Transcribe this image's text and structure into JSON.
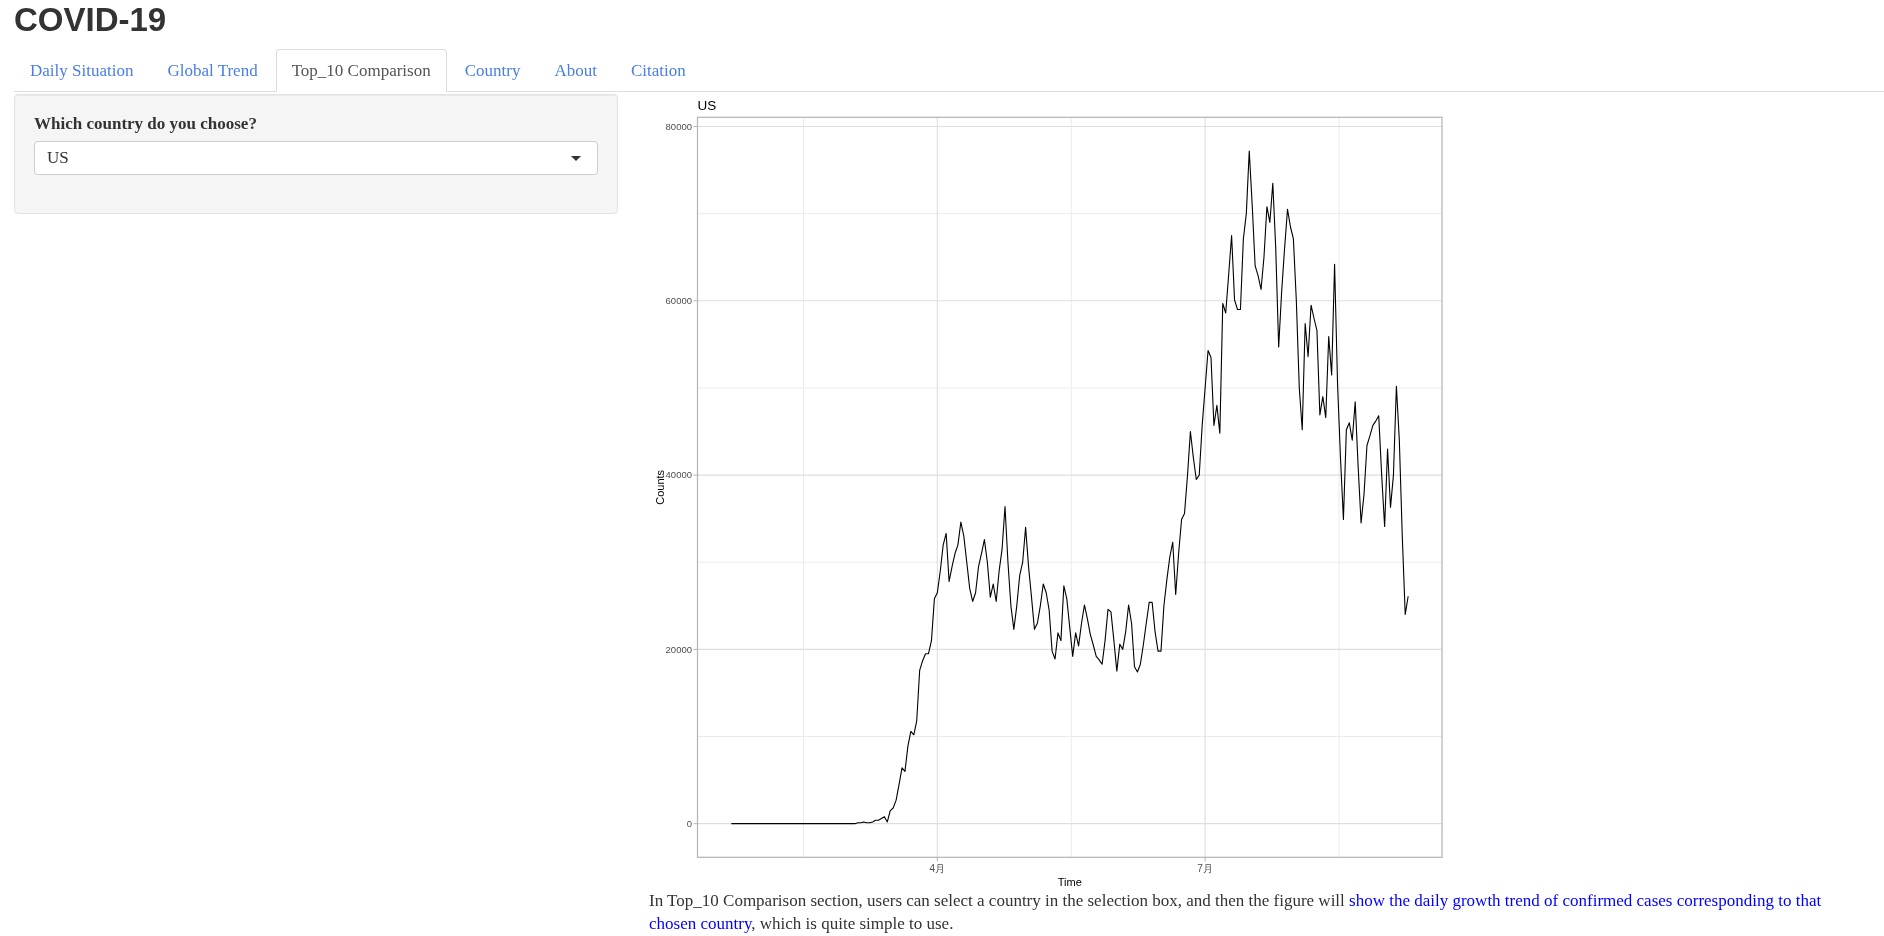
{
  "app": {
    "title": "COVID-19"
  },
  "tabs": [
    {
      "label": "Daily Situation",
      "selected": false
    },
    {
      "label": "Global Trend",
      "selected": false
    },
    {
      "label": "Top_10 Comparison",
      "selected": true
    },
    {
      "label": "Country",
      "selected": false
    },
    {
      "label": "About",
      "selected": false
    },
    {
      "label": "Citation",
      "selected": false
    }
  ],
  "sidebar": {
    "field_label": "Which country do you choose?",
    "country_select": {
      "value": "US"
    }
  },
  "main": {
    "chart_data": {
      "type": "line",
      "title": "US",
      "xlabel": "Time",
      "ylabel": "Counts",
      "grid": true,
      "categories": [
        null,
        null,
        null,
        null,
        null,
        null,
        null,
        null,
        null,
        null,
        null,
        null,
        null,
        null,
        null,
        null,
        null,
        null,
        null,
        null,
        null,
        null,
        null,
        null,
        null,
        null,
        null,
        null,
        null,
        null,
        null,
        null,
        null,
        null,
        null,
        null,
        null,
        null,
        null,
        null,
        null,
        null,
        null,
        null,
        null,
        null,
        null,
        null,
        null,
        null,
        null,
        null,
        null,
        null,
        null,
        null,
        null,
        null,
        null,
        null,
        null,
        null,
        null,
        null,
        null,
        null,
        null,
        null,
        null,
        null,
        "4月",
        null,
        null,
        null,
        null,
        null,
        null,
        null,
        null,
        null,
        null,
        null,
        null,
        null,
        null,
        null,
        null,
        null,
        null,
        null,
        null,
        null,
        null,
        null,
        null,
        null,
        null,
        null,
        null,
        null,
        null,
        null,
        null,
        null,
        null,
        null,
        null,
        null,
        null,
        null,
        null,
        null,
        null,
        null,
        null,
        null,
        null,
        null,
        null,
        null,
        null,
        null,
        null,
        null,
        null,
        null,
        null,
        null,
        null,
        null,
        null,
        null,
        null,
        null,
        null,
        null,
        null,
        null,
        null,
        null,
        null,
        null,
        null,
        null,
        null,
        null,
        null,
        null,
        null,
        null,
        null,
        null,
        null,
        null,
        null,
        null,
        null,
        null,
        null,
        null,
        null,
        "7月",
        null,
        null,
        null,
        null,
        null,
        null,
        null,
        null,
        null,
        null,
        null,
        null,
        null,
        null,
        null,
        null,
        null,
        null,
        null,
        null,
        null,
        null,
        null,
        null,
        null,
        null,
        null,
        null,
        null,
        null,
        null,
        null,
        null,
        null,
        null,
        null,
        null,
        null,
        null,
        null,
        null,
        null,
        null,
        null,
        null,
        null,
        null,
        null,
        null,
        null,
        null,
        null,
        null,
        null,
        null,
        null,
        null,
        null,
        null,
        null,
        null,
        null,
        null,
        null,
        null,
        null,
        null,
        null,
        null
      ],
      "values": [
        0,
        0,
        0,
        0,
        0,
        0,
        0,
        0,
        0,
        0,
        0,
        0,
        0,
        0,
        0,
        0,
        0,
        0,
        0,
        0,
        0,
        0,
        0,
        0,
        0,
        0,
        0,
        0,
        0,
        0,
        0,
        0,
        0,
        0,
        0,
        0,
        0,
        0,
        0,
        0,
        0,
        0,
        0,
        100,
        100,
        200,
        100,
        100,
        200,
        400,
        400,
        600,
        800,
        200,
        1500,
        1800,
        2700,
        4500,
        6400,
        6000,
        8900,
        10600,
        10200,
        11800,
        17600,
        18700,
        19500,
        19500,
        21000,
        25800,
        26500,
        29000,
        32000,
        33300,
        27800,
        29500,
        31000,
        32000,
        34600,
        33000,
        30000,
        27000,
        25500,
        26500,
        29500,
        31000,
        32600,
        30000,
        26000,
        27500,
        25500,
        29000,
        31500,
        36400,
        30000,
        25000,
        22300,
        25000,
        28500,
        30000,
        34000,
        29500,
        26000,
        22300,
        23000,
        25000,
        27500,
        26500,
        24500,
        19800,
        18900,
        21900,
        21000,
        27300,
        25800,
        22500,
        19200,
        21900,
        20400,
        23000,
        25100,
        23500,
        21700,
        20500,
        19200,
        18800,
        18300,
        21000,
        24600,
        24300,
        21000,
        17500,
        20600,
        20000,
        22000,
        25100,
        23000,
        18000,
        17400,
        18300,
        20500,
        23000,
        25400,
        25400,
        22000,
        19800,
        19800,
        25000,
        28000,
        30600,
        32300,
        26300,
        31000,
        34900,
        35600,
        39900,
        45000,
        42000,
        39500,
        40000,
        45700,
        50000,
        54300,
        53500,
        45700,
        48000,
        44800,
        59700,
        58600,
        63000,
        67500,
        60100,
        59000,
        59000,
        67100,
        70000,
        77200,
        71000,
        64000,
        62900,
        61300,
        65000,
        70800,
        69000,
        73500,
        66000,
        54700,
        61000,
        66000,
        70500,
        68500,
        67100,
        60000,
        50000,
        45200,
        57400,
        53600,
        59500,
        58000,
        56600,
        46900,
        49000,
        46600,
        55900,
        51500,
        64200,
        50500,
        42000,
        34900,
        45200,
        46000,
        44000,
        48400,
        41000,
        34500,
        37800,
        43400,
        44500,
        45700,
        46200,
        46800,
        40000,
        34100,
        43000,
        36300,
        40000,
        50200,
        44000,
        33000,
        24000,
        26100
      ],
      "ylim": [
        -3860,
        81060
      ],
      "yticks": [
        0,
        20000,
        40000,
        60000,
        80000
      ]
    },
    "description": [
      {
        "text": "In Top_10 Comparison section, users can select a country in the selection box, and then the figure will ",
        "highlighted": false
      },
      {
        "text": "show the daily growth trend of confirmed cases corresponding to that chosen country",
        "highlighted": true
      },
      {
        "text": ", which is quite simple to use.",
        "highlighted": false
      }
    ]
  }
}
